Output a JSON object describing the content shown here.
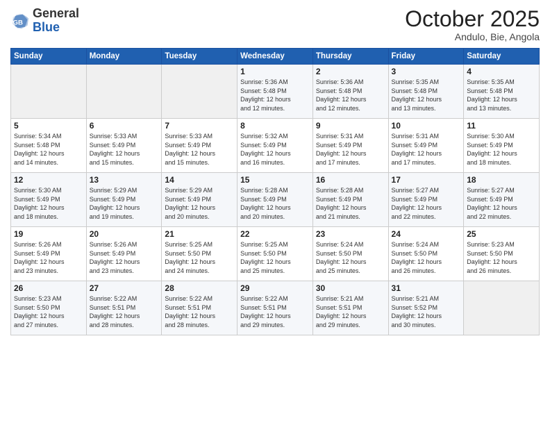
{
  "logo": {
    "general": "General",
    "blue": "Blue"
  },
  "header": {
    "month": "October 2025",
    "location": "Andulo, Bie, Angola"
  },
  "weekdays": [
    "Sunday",
    "Monday",
    "Tuesday",
    "Wednesday",
    "Thursday",
    "Friday",
    "Saturday"
  ],
  "weeks": [
    [
      {
        "day": "",
        "info": ""
      },
      {
        "day": "",
        "info": ""
      },
      {
        "day": "",
        "info": ""
      },
      {
        "day": "1",
        "info": "Sunrise: 5:36 AM\nSunset: 5:48 PM\nDaylight: 12 hours\nand 12 minutes."
      },
      {
        "day": "2",
        "info": "Sunrise: 5:36 AM\nSunset: 5:48 PM\nDaylight: 12 hours\nand 12 minutes."
      },
      {
        "day": "3",
        "info": "Sunrise: 5:35 AM\nSunset: 5:48 PM\nDaylight: 12 hours\nand 13 minutes."
      },
      {
        "day": "4",
        "info": "Sunrise: 5:35 AM\nSunset: 5:48 PM\nDaylight: 12 hours\nand 13 minutes."
      }
    ],
    [
      {
        "day": "5",
        "info": "Sunrise: 5:34 AM\nSunset: 5:48 PM\nDaylight: 12 hours\nand 14 minutes."
      },
      {
        "day": "6",
        "info": "Sunrise: 5:33 AM\nSunset: 5:49 PM\nDaylight: 12 hours\nand 15 minutes."
      },
      {
        "day": "7",
        "info": "Sunrise: 5:33 AM\nSunset: 5:49 PM\nDaylight: 12 hours\nand 15 minutes."
      },
      {
        "day": "8",
        "info": "Sunrise: 5:32 AM\nSunset: 5:49 PM\nDaylight: 12 hours\nand 16 minutes."
      },
      {
        "day": "9",
        "info": "Sunrise: 5:31 AM\nSunset: 5:49 PM\nDaylight: 12 hours\nand 17 minutes."
      },
      {
        "day": "10",
        "info": "Sunrise: 5:31 AM\nSunset: 5:49 PM\nDaylight: 12 hours\nand 17 minutes."
      },
      {
        "day": "11",
        "info": "Sunrise: 5:30 AM\nSunset: 5:49 PM\nDaylight: 12 hours\nand 18 minutes."
      }
    ],
    [
      {
        "day": "12",
        "info": "Sunrise: 5:30 AM\nSunset: 5:49 PM\nDaylight: 12 hours\nand 18 minutes."
      },
      {
        "day": "13",
        "info": "Sunrise: 5:29 AM\nSunset: 5:49 PM\nDaylight: 12 hours\nand 19 minutes."
      },
      {
        "day": "14",
        "info": "Sunrise: 5:29 AM\nSunset: 5:49 PM\nDaylight: 12 hours\nand 20 minutes."
      },
      {
        "day": "15",
        "info": "Sunrise: 5:28 AM\nSunset: 5:49 PM\nDaylight: 12 hours\nand 20 minutes."
      },
      {
        "day": "16",
        "info": "Sunrise: 5:28 AM\nSunset: 5:49 PM\nDaylight: 12 hours\nand 21 minutes."
      },
      {
        "day": "17",
        "info": "Sunrise: 5:27 AM\nSunset: 5:49 PM\nDaylight: 12 hours\nand 22 minutes."
      },
      {
        "day": "18",
        "info": "Sunrise: 5:27 AM\nSunset: 5:49 PM\nDaylight: 12 hours\nand 22 minutes."
      }
    ],
    [
      {
        "day": "19",
        "info": "Sunrise: 5:26 AM\nSunset: 5:49 PM\nDaylight: 12 hours\nand 23 minutes."
      },
      {
        "day": "20",
        "info": "Sunrise: 5:26 AM\nSunset: 5:49 PM\nDaylight: 12 hours\nand 23 minutes."
      },
      {
        "day": "21",
        "info": "Sunrise: 5:25 AM\nSunset: 5:50 PM\nDaylight: 12 hours\nand 24 minutes."
      },
      {
        "day": "22",
        "info": "Sunrise: 5:25 AM\nSunset: 5:50 PM\nDaylight: 12 hours\nand 25 minutes."
      },
      {
        "day": "23",
        "info": "Sunrise: 5:24 AM\nSunset: 5:50 PM\nDaylight: 12 hours\nand 25 minutes."
      },
      {
        "day": "24",
        "info": "Sunrise: 5:24 AM\nSunset: 5:50 PM\nDaylight: 12 hours\nand 26 minutes."
      },
      {
        "day": "25",
        "info": "Sunrise: 5:23 AM\nSunset: 5:50 PM\nDaylight: 12 hours\nand 26 minutes."
      }
    ],
    [
      {
        "day": "26",
        "info": "Sunrise: 5:23 AM\nSunset: 5:50 PM\nDaylight: 12 hours\nand 27 minutes."
      },
      {
        "day": "27",
        "info": "Sunrise: 5:22 AM\nSunset: 5:51 PM\nDaylight: 12 hours\nand 28 minutes."
      },
      {
        "day": "28",
        "info": "Sunrise: 5:22 AM\nSunset: 5:51 PM\nDaylight: 12 hours\nand 28 minutes."
      },
      {
        "day": "29",
        "info": "Sunrise: 5:22 AM\nSunset: 5:51 PM\nDaylight: 12 hours\nand 29 minutes."
      },
      {
        "day": "30",
        "info": "Sunrise: 5:21 AM\nSunset: 5:51 PM\nDaylight: 12 hours\nand 29 minutes."
      },
      {
        "day": "31",
        "info": "Sunrise: 5:21 AM\nSunset: 5:52 PM\nDaylight: 12 hours\nand 30 minutes."
      },
      {
        "day": "",
        "info": ""
      }
    ]
  ]
}
